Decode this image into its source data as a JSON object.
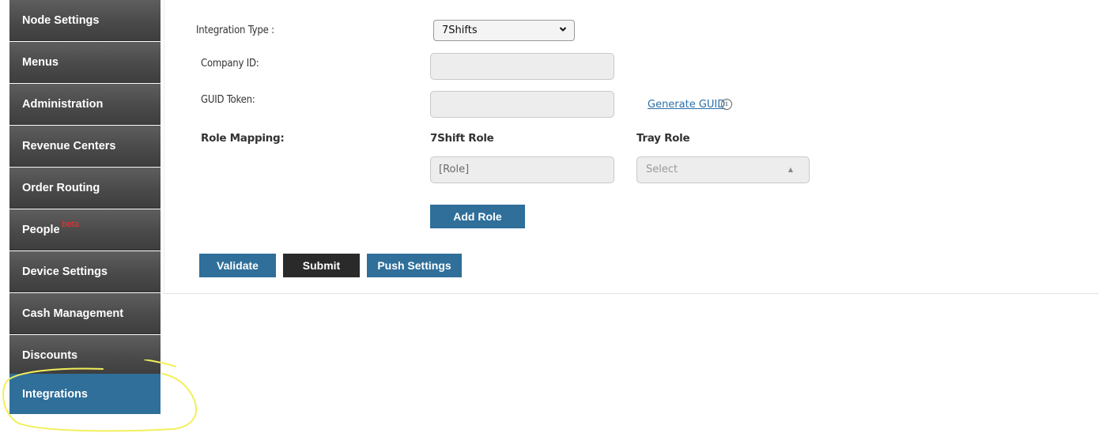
{
  "sidebar": {
    "items": [
      {
        "label": "Node Settings"
      },
      {
        "label": "Menus"
      },
      {
        "label": "Administration"
      },
      {
        "label": "Revenue Centers"
      },
      {
        "label": "Order Routing"
      },
      {
        "label": "People",
        "badge": "beta"
      },
      {
        "label": "Device Settings"
      },
      {
        "label": "Cash Management"
      },
      {
        "label": "Discounts"
      },
      {
        "label": "Integrations",
        "active": true
      }
    ]
  },
  "form": {
    "integration_type_label": "Integration Type :",
    "integration_type_value": "7Shifts",
    "company_id_label": "Company ID:",
    "company_id_value": "",
    "guid_token_label": "GUID Token:",
    "guid_token_value": "",
    "generate_guid_link": "Generate GUID",
    "info_icon_glyph": "i",
    "role_mapping_label": "Role Mapping:",
    "col_7shift_role": "7Shift Role",
    "col_tray_role": "Tray Role",
    "role_placeholder": "[Role]",
    "tray_role_placeholder": "Select",
    "add_role_label": "Add Role"
  },
  "actions": {
    "validate_label": "Validate",
    "submit_label": "Submit",
    "push_settings_label": "Push Settings"
  },
  "colors": {
    "accent_blue": "#2f6f9a",
    "sidebar_dark": "#4a4a4a",
    "beta_red": "#ff2a2a",
    "annotation_yellow": "#f2ef5a"
  }
}
